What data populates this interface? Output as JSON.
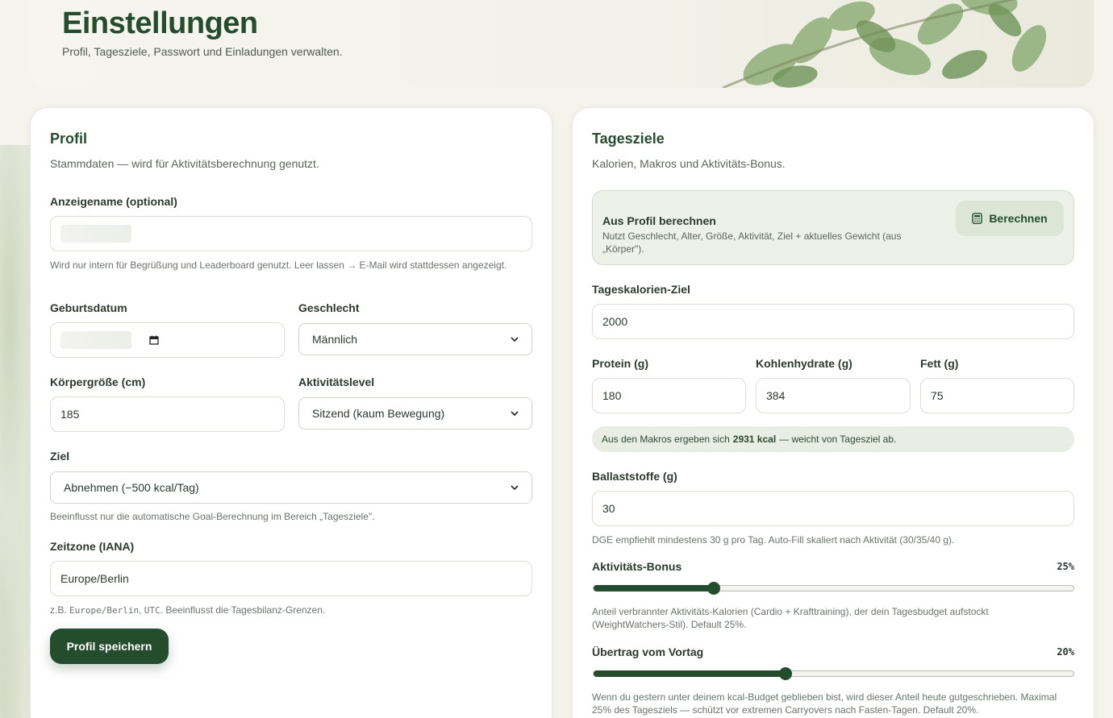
{
  "header": {
    "title": "Einstellungen",
    "subtitle": "Profil, Tagesziele, Passwort und Einladungen verwalten."
  },
  "profile": {
    "title": "Profil",
    "subtitle": "Stammdaten — wird für Aktivitätsberechnung genutzt.",
    "display_name_label": "Anzeigename (optional)",
    "display_name_value": "",
    "display_name_hint": "Wird nur intern für Begrüßung und Leaderboard genutzt. Leer lassen → E-Mail wird stattdessen angezeigt.",
    "birthdate_label": "Geburtsdatum",
    "birthdate_value": "",
    "gender_label": "Geschlecht",
    "gender_value": "Männlich",
    "height_label": "Körpergröße (cm)",
    "height_value": "185",
    "activity_label": "Aktivitätslevel",
    "activity_value": "Sitzend (kaum Bewegung)",
    "goal_label": "Ziel",
    "goal_value": "Abnehmen (−500 kcal/Tag)",
    "goal_hint": "Beeinflusst nur die automatische Goal-Berechnung im Bereich „Tagesziele\".",
    "timezone_label": "Zeitzone (IANA)",
    "timezone_value": "Europe/Berlin",
    "timezone_hint_prefix": "z.B. ",
    "timezone_hint_code1": "Europe/Berlin",
    "timezone_hint_sep": ", ",
    "timezone_hint_code2": "UTC",
    "timezone_hint_suffix": ". Beeinflusst die Tagesbilanz-Grenzen.",
    "save_label": "Profil speichern"
  },
  "goals": {
    "title": "Tagesziele",
    "subtitle": "Kalorien, Makros und Aktivitäts-Bonus.",
    "calc_title": "Aus Profil berechnen",
    "calc_sub": "Nutzt Geschlecht, Alter, Größe, Aktivität, Ziel + aktuelles Gewicht (aus „Körper\").",
    "calc_button": "Berechnen",
    "kcal_label": "Tageskalorien-Ziel",
    "kcal_value": "2000",
    "protein_label": "Protein (g)",
    "protein_value": "180",
    "carbs_label": "Kohlenhydrate (g)",
    "carbs_value": "384",
    "fat_label": "Fett (g)",
    "fat_value": "75",
    "macro_note_prefix": "Aus den Makros ergeben sich",
    "macro_note_kcal": "2931 kcal",
    "macro_note_suffix": "— weicht von Tagesziel ab.",
    "fiber_label": "Ballaststoffe (g)",
    "fiber_value": "30",
    "fiber_hint": "DGE empfiehlt mindestens 30 g pro Tag. Auto-Fill skaliert nach Aktivität (30/35/40 g).",
    "activity_bonus_label": "Aktivitäts-Bonus",
    "activity_bonus_pct": "25%",
    "activity_bonus_value": 25,
    "activity_bonus_max": 100,
    "activity_bonus_hint": "Anteil verbrannter Aktivitäts-Kalorien (Cardio + Krafttraining), der dein Tagesbudget aufstockt (WeightWatchers-Stil). Default 25%.",
    "carryover_label": "Übertrag vom Vortag",
    "carryover_pct": "20%",
    "carryover_value": 20,
    "carryover_max": 50,
    "carryover_hint": "Wenn du gestern unter deinem kcal-Budget geblieben bist, wird dieser Anteil heute gutgeschrieben. Maximal 25% des Tagesziels — schützt vor extremen Carryovers nach Fasten-Tagen. Default 20%."
  },
  "colors": {
    "accent": "#234d2c",
    "calc_box_bg": "#edf2e9",
    "note_bg": "#e8eee4"
  }
}
